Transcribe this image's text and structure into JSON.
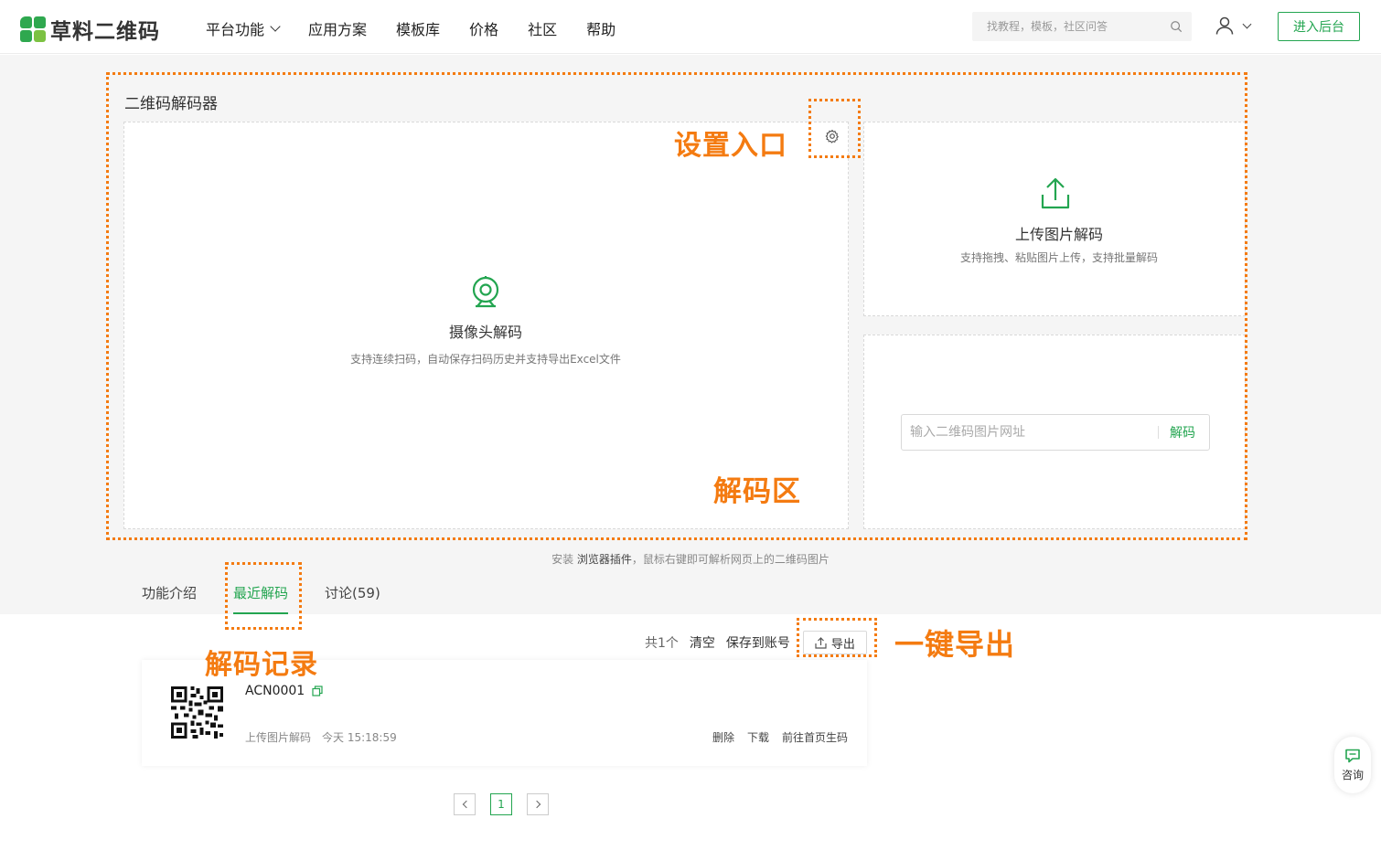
{
  "header": {
    "logo_text": "草料二维码",
    "nav": [
      {
        "label": "平台功能",
        "has_dropdown": true
      },
      {
        "label": "应用方案"
      },
      {
        "label": "模板库"
      },
      {
        "label": "价格"
      },
      {
        "label": "社区"
      },
      {
        "label": "帮助"
      }
    ],
    "search_placeholder": "找教程，模板，社区问答",
    "admin_label": "进入后台"
  },
  "decoder": {
    "title": "二维码解码器",
    "camera": {
      "title": "摄像头解码",
      "subtitle": "支持连续扫码，自动保存扫码历史并支持导出Excel文件"
    },
    "upload": {
      "title": "上传图片解码",
      "subtitle": "支持拖拽、粘贴图片上传，支持批量解码"
    },
    "url": {
      "placeholder": "输入二维码图片网址",
      "button": "解码"
    },
    "plugin_note": {
      "prefix": "安装 ",
      "link": "浏览器插件",
      "suffix": "，鼠标右键即可解析网页上的二维码图片"
    }
  },
  "tabs": [
    {
      "label": "功能介绍",
      "active": false
    },
    {
      "label": "最近解码",
      "active": true
    },
    {
      "label": "讨论(59)",
      "active": false
    }
  ],
  "toolbar": {
    "count": "共1个",
    "clear": "清空",
    "save": "保存到账号",
    "export": "导出"
  },
  "records": [
    {
      "title": "ACN0001",
      "source": "上传图片解码",
      "time": "今天 15:18:59",
      "actions": [
        "删除",
        "下载",
        "前往首页生码"
      ]
    }
  ],
  "pagination": {
    "current": "1"
  },
  "consult": {
    "label": "咨询"
  },
  "annotations": {
    "settings": "设置入口",
    "decode_area": "解码区",
    "records": "解码记录",
    "export": "一键导出"
  },
  "colors": {
    "brand": "#23a550",
    "annotation": "#f47b11"
  }
}
